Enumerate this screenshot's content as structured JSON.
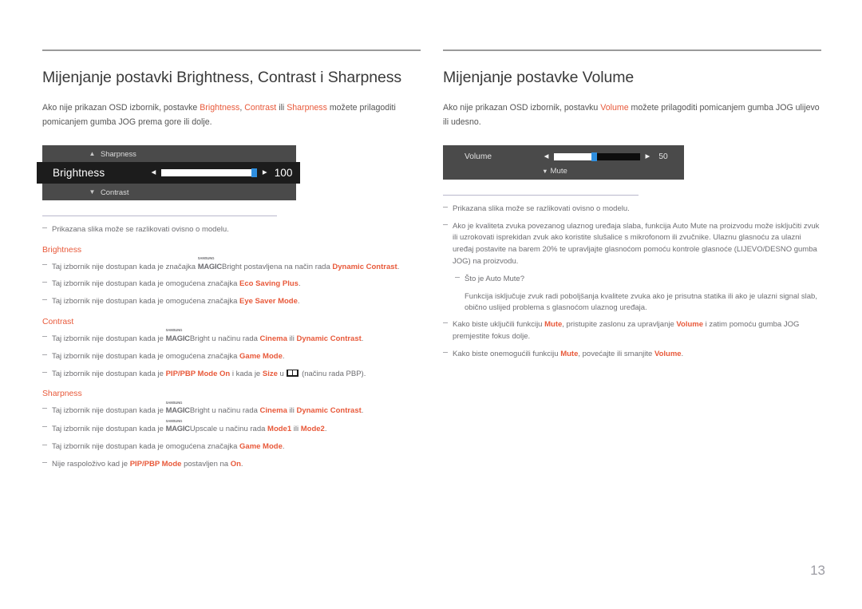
{
  "colors": {
    "accent": "#e8593a",
    "body_text": "#6e6e72",
    "heading": "#3a3a3a",
    "rule": "#9a9a9a",
    "note_rule": "#b9b8cc",
    "osd_bg": "#4a4a4a",
    "osd_selected_bg": "#1c1c1c",
    "slider_thumb": "#2f8fe0",
    "page_number": "#9d9da4"
  },
  "page_number": "13",
  "left": {
    "title": "Mijenjanje postavki Brightness, Contrast i Sharpness",
    "intro": {
      "p1": "Ako nije prikazan OSD izbornik, postavke ",
      "t1": "Brightness",
      "p2": ", ",
      "t2": "Contrast",
      "p3": " ili ",
      "t3": "Sharpness",
      "p4": " možete prilagoditi pomicanjem gumba JOG prema gore ili dolje."
    },
    "osd": {
      "top_label": "Sharpness",
      "top_chevron": "chevron-up-icon",
      "main_label": "Brightness",
      "main_value": "100",
      "fill_percent": 100,
      "left_arrow": "◀",
      "right_arrow": "▶",
      "bottom_label": "Contrast",
      "bottom_chevron": "chevron-down-icon"
    },
    "image_note": "Prikazana slika može se razlikovati ovisno o modelu.",
    "sections": [
      {
        "heading": "Brightness",
        "notes": [
          {
            "parts": [
              {
                "t": "Taj izbornik nije dostupan kada je značajka ",
                "s": "plain"
              },
              {
                "t": "MAGIC",
                "sup": "SAMSUNG",
                "suffix": "Bright",
                "s": "smagic"
              },
              {
                "t": " postavljena na način rada ",
                "s": "plain"
              },
              {
                "t": "Dynamic Contrast",
                "s": "hl"
              },
              {
                "t": ".",
                "s": "plain"
              }
            ]
          },
          {
            "parts": [
              {
                "t": "Taj izbornik nije dostupan kada je omogućena značajka ",
                "s": "plain"
              },
              {
                "t": "Eco Saving Plus",
                "s": "hl"
              },
              {
                "t": ".",
                "s": "plain"
              }
            ]
          },
          {
            "parts": [
              {
                "t": "Taj izbornik nije dostupan kada je omogućena značajka ",
                "s": "plain"
              },
              {
                "t": "Eye Saver Mode",
                "s": "hl"
              },
              {
                "t": ".",
                "s": "plain"
              }
            ]
          }
        ]
      },
      {
        "heading": "Contrast",
        "notes": [
          {
            "parts": [
              {
                "t": "Taj izbornik nije dostupan kada je ",
                "s": "plain"
              },
              {
                "t": "MAGIC",
                "sup": "SAMSUNG",
                "suffix": "Bright",
                "s": "smagic"
              },
              {
                "t": " u načinu rada ",
                "s": "plain"
              },
              {
                "t": "Cinema",
                "s": "hl"
              },
              {
                "t": " ili ",
                "s": "plain"
              },
              {
                "t": "Dynamic Contrast",
                "s": "hl"
              },
              {
                "t": ".",
                "s": "plain"
              }
            ]
          },
          {
            "parts": [
              {
                "t": "Taj izbornik nije dostupan kada je omogućena značajka ",
                "s": "plain"
              },
              {
                "t": "Game Mode",
                "s": "hl"
              },
              {
                "t": ".",
                "s": "plain"
              }
            ]
          },
          {
            "parts": [
              {
                "t": "Taj izbornik nije dostupan kada je ",
                "s": "plain"
              },
              {
                "t": "PIP/PBP Mode On",
                "s": "hl"
              },
              {
                "t": " i kada je ",
                "s": "plain"
              },
              {
                "t": "Size",
                "s": "hl"
              },
              {
                "t": " u ",
                "s": "plain"
              },
              {
                "t": "",
                "s": "pbp-icon"
              },
              {
                "t": " (načinu rada PBP).",
                "s": "plain"
              }
            ]
          }
        ]
      },
      {
        "heading": "Sharpness",
        "notes": [
          {
            "parts": [
              {
                "t": "Taj izbornik nije dostupan kada je ",
                "s": "plain"
              },
              {
                "t": "MAGIC",
                "sup": "SAMSUNG",
                "suffix": "Bright",
                "s": "smagic"
              },
              {
                "t": " u načinu rada ",
                "s": "plain"
              },
              {
                "t": "Cinema",
                "s": "hl"
              },
              {
                "t": " ili ",
                "s": "plain"
              },
              {
                "t": "Dynamic Contrast",
                "s": "hl"
              },
              {
                "t": ".",
                "s": "plain"
              }
            ]
          },
          {
            "parts": [
              {
                "t": "Taj izbornik nije dostupan kada je ",
                "s": "plain"
              },
              {
                "t": "MAGIC",
                "sup": "SAMSUNG",
                "suffix": "Upscale",
                "s": "smagic"
              },
              {
                "t": " u načinu rada ",
                "s": "plain"
              },
              {
                "t": "Mode1",
                "s": "hl"
              },
              {
                "t": " ili ",
                "s": "plain"
              },
              {
                "t": "Mode2",
                "s": "hl"
              },
              {
                "t": ".",
                "s": "plain"
              }
            ]
          },
          {
            "parts": [
              {
                "t": "Taj izbornik nije dostupan kada je omogućena značajka ",
                "s": "plain"
              },
              {
                "t": "Game Mode",
                "s": "hl"
              },
              {
                "t": ".",
                "s": "plain"
              }
            ]
          },
          {
            "parts": [
              {
                "t": "Nije raspoloživo kad je ",
                "s": "plain"
              },
              {
                "t": "PIP/PBP Mode",
                "s": "hl"
              },
              {
                "t": " postavljen na ",
                "s": "plain"
              },
              {
                "t": "On",
                "s": "hl"
              },
              {
                "t": ".",
                "s": "plain"
              }
            ]
          }
        ]
      }
    ]
  },
  "right": {
    "title": "Mijenjanje postavke Volume",
    "intro": {
      "p1": "Ako nije prikazan OSD izbornik, postavku ",
      "t1": "Volume",
      "p2": " možete prilagoditi pomicanjem gumba JOG ulijevo ili udesno."
    },
    "osd": {
      "main_label": "Volume",
      "main_value": "50",
      "fill_percent": 50,
      "left_arrow": "◀",
      "right_arrow": "▶",
      "mute_label": "Mute",
      "mute_chevron": "chevron-down-icon"
    },
    "image_note": "Prikazana slika može se razlikovati ovisno o modelu.",
    "notes": [
      {
        "parts": [
          {
            "t": "Ako je kvaliteta zvuka povezanog ulaznog uređaja slaba, funkcija Auto Mute na proizvodu može isključiti zvuk ili uzrokovati isprekidan zvuk ako koristite slušalice s mikrofonom ili zvučnike. Ulaznu glasnoću za ulazni uređaj postavite na barem 20% te upravljajte glasnoćom pomoću kontrole glasnoće (LIJEVO/DESNO gumba JOG) na proizvodu.",
            "s": "plain"
          }
        ]
      },
      {
        "sub": true,
        "parts": [
          {
            "t": "Što je Auto Mute?",
            "s": "plain"
          }
        ]
      },
      {
        "plain": true,
        "parts": [
          {
            "t": "Funkcija isključuje zvuk radi poboljšanja kvalitete zvuka ako je prisutna statika ili ako je ulazni signal slab, obično uslijed problema s glasnoćom ulaznog uređaja.",
            "s": "plain"
          }
        ]
      },
      {
        "parts": [
          {
            "t": "Kako biste uključili funkciju ",
            "s": "plain"
          },
          {
            "t": "Mute",
            "s": "hl"
          },
          {
            "t": ", pristupite zaslonu za upravljanje ",
            "s": "plain"
          },
          {
            "t": "Volume",
            "s": "hl"
          },
          {
            "t": " i zatim pomoću gumba JOG premjestite fokus dolje.",
            "s": "plain"
          }
        ]
      },
      {
        "parts": [
          {
            "t": "Kako biste onemogućili funkciju ",
            "s": "plain"
          },
          {
            "t": "Mute",
            "s": "hl"
          },
          {
            "t": ", povećajte ili smanjite ",
            "s": "plain"
          },
          {
            "t": "Volume",
            "s": "hl"
          },
          {
            "t": ".",
            "s": "plain"
          }
        ]
      }
    ]
  }
}
